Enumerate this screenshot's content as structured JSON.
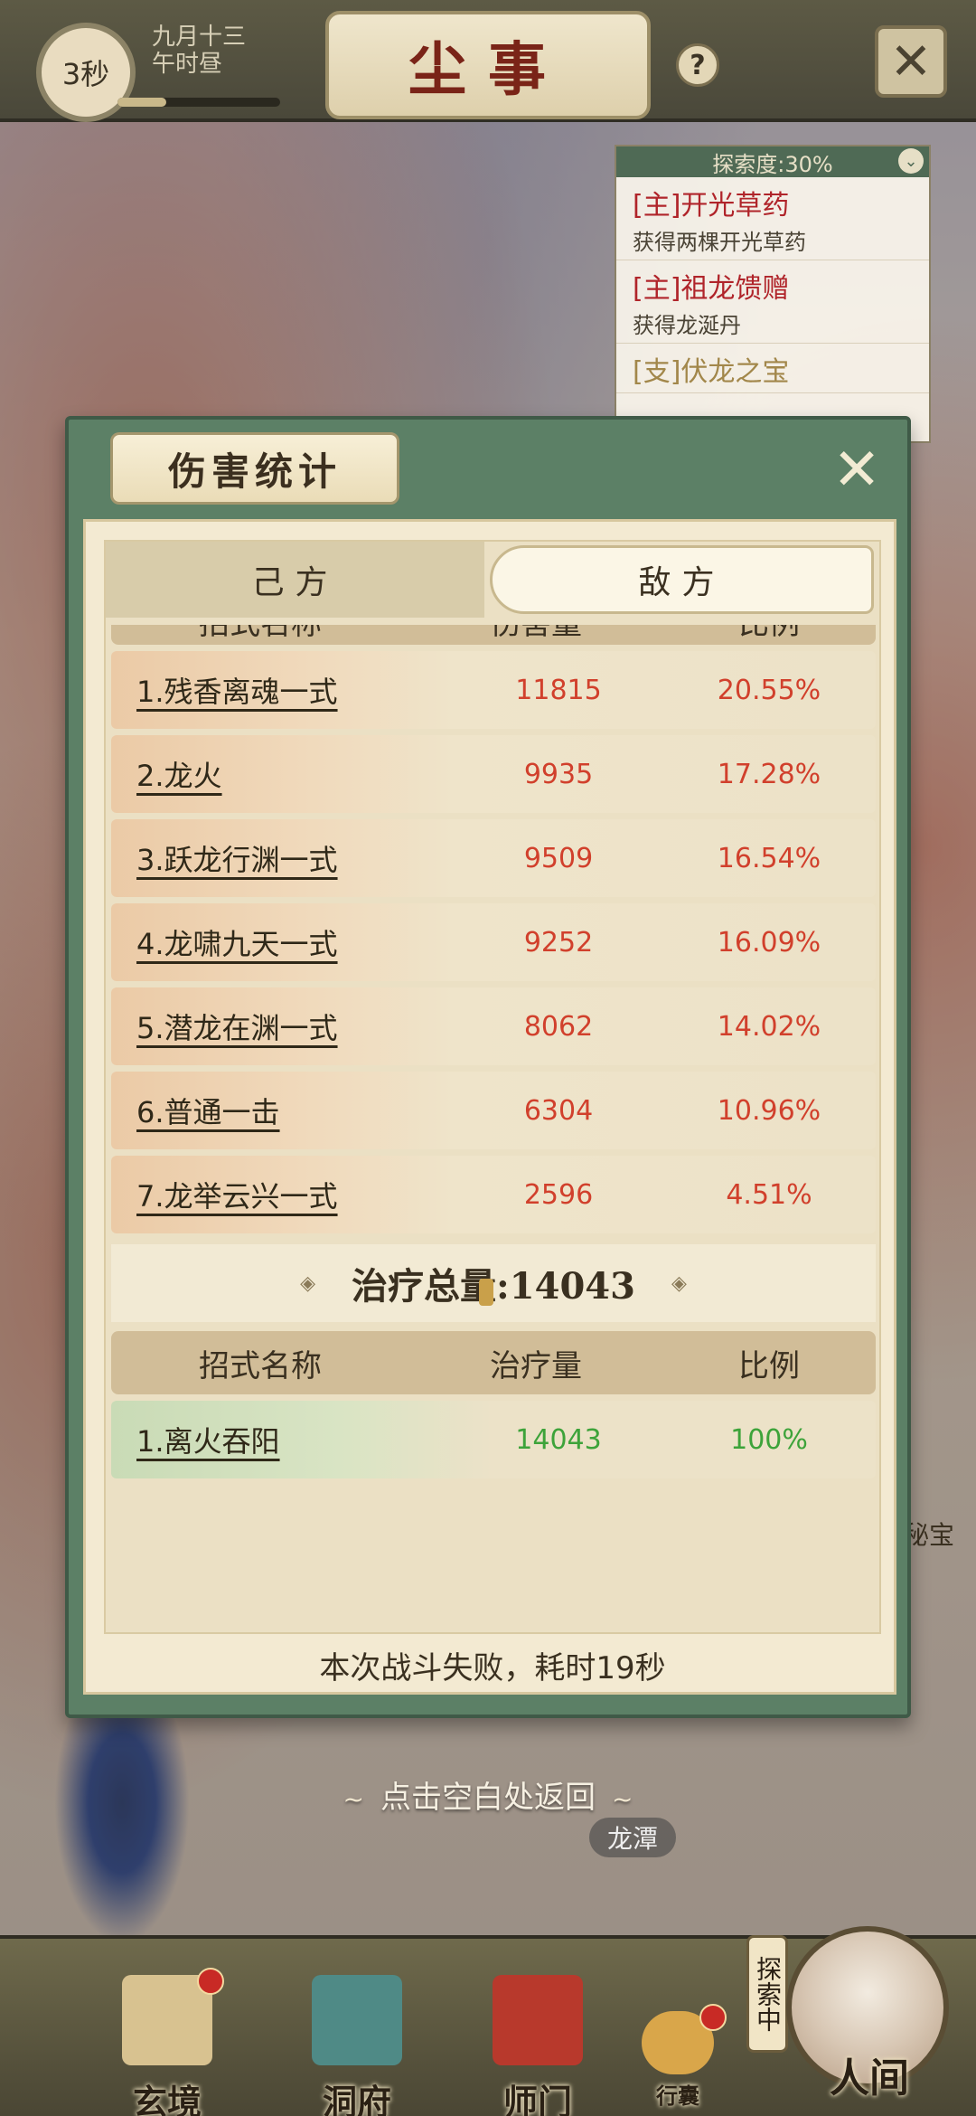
{
  "top": {
    "timer": "3秒",
    "date_line1": "九月十三",
    "date_line2": "午时昼",
    "title": "尘事",
    "help": "?"
  },
  "quest": {
    "progress_label": "探索度:30%",
    "items": [
      {
        "title": "[主]开光草药",
        "desc": "获得两棵开光草药"
      },
      {
        "title": "[主]祖龙馈赠",
        "desc": "获得龙涎丹"
      },
      {
        "title": "[支]伏龙之宝",
        "desc": ""
      }
    ]
  },
  "dialog": {
    "title": "伤害统计",
    "tabs": [
      "己方",
      "敌方"
    ],
    "active_tab": 1,
    "damage_headers": [
      "招式名称",
      "伤害量",
      "比例"
    ],
    "damage_rows": [
      {
        "name": "1.残香离魂一式",
        "amount": "11815",
        "ratio": "20.55%"
      },
      {
        "name": "2.龙火",
        "amount": "9935",
        "ratio": "17.28%"
      },
      {
        "name": "3.跃龙行渊一式",
        "amount": "9509",
        "ratio": "16.54%"
      },
      {
        "name": "4.龙啸九天一式",
        "amount": "9252",
        "ratio": "16.09%"
      },
      {
        "name": "5.潜龙在渊一式",
        "amount": "8062",
        "ratio": "14.02%"
      },
      {
        "name": "6.普通一击",
        "amount": "6304",
        "ratio": "10.96%"
      },
      {
        "name": "7.龙举云兴一式",
        "amount": "2596",
        "ratio": "4.51%"
      }
    ],
    "heal_total": "治疗总量:14043",
    "heal_headers": [
      "招式名称",
      "治疗量",
      "比例"
    ],
    "heal_rows": [
      {
        "name": "1.离火吞阳",
        "amount": "14043",
        "ratio": "100%"
      }
    ],
    "result": "本次战斗失败，耗时19秒"
  },
  "tap_return": "点击空白处返回",
  "location_tag": "龙潭",
  "side_text": "秘宝",
  "nav": {
    "items": [
      "玄境",
      "洞府",
      "师门",
      "行囊"
    ],
    "explore": "探索中",
    "world": "人间"
  }
}
